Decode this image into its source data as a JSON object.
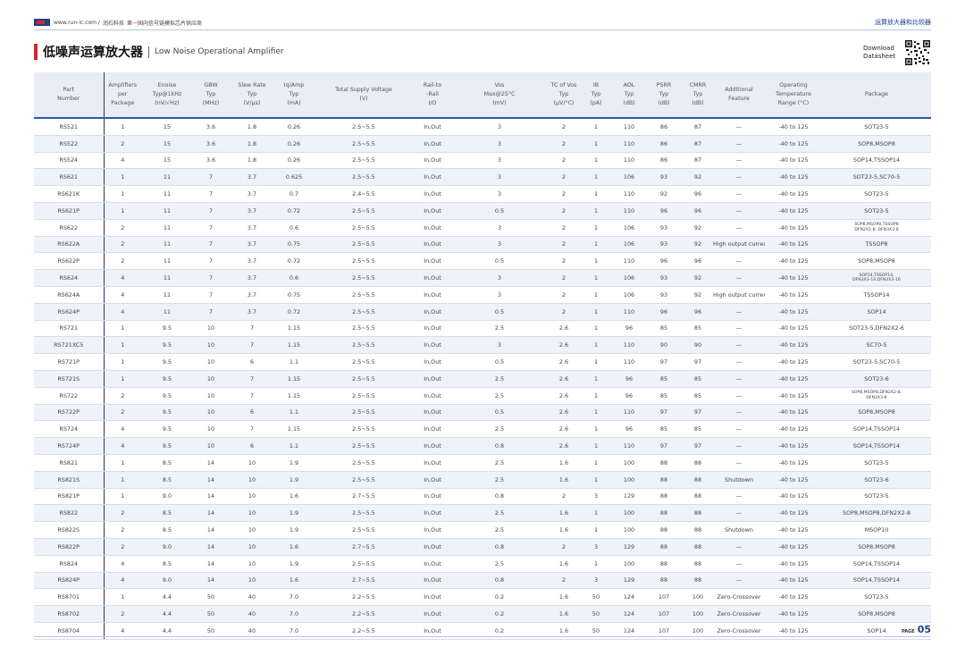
{
  "header": {
    "site_text": "www.run-ic.com /",
    "brand_text": "润石科技",
    "slogan_prefix": "第",
    "slogan_mark": "一",
    "slogan": "国内信号链模拟芯片供应商",
    "category": "运算放大器和比较器"
  },
  "title": {
    "zh": "低噪声运算放大器",
    "en": "Low Noise Operational Amplifier"
  },
  "download": {
    "line1": "Download",
    "line2": "Datasheet"
  },
  "table": {
    "columns": [
      "Part\nNumber",
      "Amplifiers\nper\nPackage",
      "Enoise\nTyp@1kHz\n(nV/√Hz)",
      "GBW\nTyp\n(MHz)",
      "Slew Rate\nTyp\n(V/μs)",
      "Iq/Amp\nTyp\n(mA)",
      "Total Supply Voltage\n(V)",
      "Rail-to\n-Rail\nI/O",
      "Vos\nMax@25°C\n(mV)",
      "TC of Vos\nTyp\n(μV/°C)",
      "IB\nTyp\n(pA)",
      "AOL\nTyp\n(dB)",
      "PSRR\nTyp\n(dB)",
      "CMRR\nTyp\n(dB)",
      "Additional\nFeature",
      "Operating\nTemperature\nRange (°C)",
      "Package"
    ],
    "rows": [
      [
        "RS521",
        "1",
        "15",
        "3.6",
        "1.8",
        "0.26",
        "2.5~5.5",
        "In,Out",
        "3",
        "2",
        "1",
        "110",
        "86",
        "87",
        "—",
        "-40 to 125",
        "SOT23-5"
      ],
      [
        "RS522",
        "2",
        "15",
        "3.6",
        "1.8",
        "0.26",
        "2.5~5.5",
        "In,Out",
        "3",
        "2",
        "1",
        "110",
        "86",
        "87",
        "—",
        "-40 to 125",
        "SOP8,MSOP8"
      ],
      [
        "RS524",
        "4",
        "15",
        "3.6",
        "1.8",
        "0.26",
        "2.5~5.5",
        "In,Out",
        "3",
        "2",
        "1",
        "110",
        "86",
        "87",
        "—",
        "-40 to 125",
        "SOP14,TSSOP14"
      ],
      [
        "RS621",
        "1",
        "11",
        "7",
        "3.7",
        "0.625",
        "2.5~5.5",
        "In,Out",
        "3",
        "2",
        "1",
        "106",
        "93",
        "92",
        "—",
        "-40 to 125",
        "SOT23-5,SC70-5"
      ],
      [
        "RS621K",
        "1",
        "11",
        "7",
        "3.7",
        "0.7",
        "2.4~5.5",
        "In,Out",
        "3",
        "2",
        "1",
        "110",
        "92",
        "96",
        "—",
        "-40 to 125",
        "SOT23-5"
      ],
      [
        "RS621P",
        "1",
        "11",
        "7",
        "3.7",
        "0.72",
        "2.5~5.5",
        "In,Out",
        "0.5",
        "2",
        "1",
        "110",
        "96",
        "96",
        "—",
        "-40 to 125",
        "SOT23-5"
      ],
      [
        "RS622",
        "2",
        "11",
        "7",
        "3.7",
        "0.6",
        "2.5~5.5",
        "In,Out",
        "3",
        "2",
        "1",
        "106",
        "93",
        "92",
        "—",
        "-40 to 125",
        "SOP8,MSOP8,TSSOP8\nDFN2X2-8, DFN3X3-8"
      ],
      [
        "RS622A",
        "2",
        "11",
        "7",
        "3.7",
        "0.75",
        "2.5~5.5",
        "In,Out",
        "3",
        "2",
        "1",
        "106",
        "93",
        "92",
        "High output current",
        "-40 to 125",
        "TSSOP8"
      ],
      [
        "RS622P",
        "2",
        "11",
        "7",
        "3.7",
        "0.72",
        "2.5~5.5",
        "In,Out",
        "0.5",
        "2",
        "1",
        "110",
        "96",
        "96",
        "—",
        "-40 to 125",
        "SOP8,MSOP8"
      ],
      [
        "RS624",
        "4",
        "11",
        "7",
        "3.7",
        "0.6",
        "2.5~5.5",
        "In,Out",
        "3",
        "2",
        "1",
        "106",
        "93",
        "92",
        "—",
        "-40 to 125",
        "SOP14,TSSOP14,\nDFN3X3-14,QFN3X3-16"
      ],
      [
        "RS624A",
        "4",
        "11",
        "7",
        "3.7",
        "0.75",
        "2.5~5.5",
        "In,Out",
        "3",
        "2",
        "1",
        "106",
        "93",
        "92",
        "High output current",
        "-40 to 125",
        "TSSOP14"
      ],
      [
        "RS624P",
        "4",
        "11",
        "7",
        "3.7",
        "0.72",
        "2.5~5.5",
        "In,Out",
        "0.5",
        "2",
        "1",
        "110",
        "96",
        "96",
        "—",
        "-40 to 125",
        "SOP14"
      ],
      [
        "RS721",
        "1",
        "9.5",
        "10",
        "7",
        "1.15",
        "2.5~5.5",
        "In,Out",
        "2.5",
        "2.6",
        "1",
        "96",
        "85",
        "85",
        "—",
        "-40 to 125",
        "SOT23-5,DFN2X2-6"
      ],
      [
        "RS721XC5",
        "1",
        "9.5",
        "10",
        "7",
        "1.15",
        "2.5~5.5",
        "In,Out",
        "3",
        "2.6",
        "1",
        "110",
        "90",
        "90",
        "—",
        "-40 to 125",
        "SC70-5"
      ],
      [
        "RS721P",
        "1",
        "9.5",
        "10",
        "6",
        "1.1",
        "2.5~5.5",
        "In,Out",
        "0.5",
        "2.6",
        "1",
        "110",
        "97",
        "97",
        "—",
        "-40 to 125",
        "SOT23-5,SC70-5"
      ],
      [
        "RS721S",
        "1",
        "9.5",
        "10",
        "7",
        "1.15",
        "2.5~5.5",
        "In,Out",
        "2.5",
        "2.6",
        "1",
        "96",
        "85",
        "85",
        "—",
        "-40 to 125",
        "SOT23-6"
      ],
      [
        "RS722",
        "2",
        "9.5",
        "10",
        "7",
        "1.15",
        "2.5~5.5",
        "In,Out",
        "2.5",
        "2.6",
        "1",
        "96",
        "85",
        "85",
        "—",
        "-40 to 125",
        "SOP8,MSOP8,DFN2X2-8,\nDFN3X3-8"
      ],
      [
        "RS722P",
        "2",
        "9.5",
        "10",
        "6",
        "1.1",
        "2.5~5.5",
        "In,Out",
        "0.5",
        "2.6",
        "1",
        "110",
        "97",
        "97",
        "—",
        "-40 to 125",
        "SOP8,MSOP8"
      ],
      [
        "RS724",
        "4",
        "9.5",
        "10",
        "7",
        "1.15",
        "2.5~5.5",
        "In,Out",
        "2.5",
        "2.6",
        "1",
        "96",
        "85",
        "85",
        "—",
        "-40 to 125",
        "SOP14,TSSOP14"
      ],
      [
        "RS724P",
        "4",
        "9.5",
        "10",
        "6",
        "1.1",
        "2.5~5.5",
        "In,Out",
        "0.8",
        "2.6",
        "1",
        "110",
        "97",
        "97",
        "—",
        "-40 to 125",
        "SOP14,TSSOP14"
      ],
      [
        "RS821",
        "1",
        "8.5",
        "14",
        "10",
        "1.9",
        "2.5~5.5",
        "In,Out",
        "2.5",
        "1.6",
        "1",
        "100",
        "88",
        "88",
        "—",
        "-40 to 125",
        "SOT23-5"
      ],
      [
        "RS821S",
        "1",
        "8.5",
        "14",
        "10",
        "1.9",
        "2.5~5.5",
        "In,Out",
        "2.5",
        "1.6",
        "1",
        "100",
        "88",
        "88",
        "Shutdown",
        "-40 to 125",
        "SOT23-6"
      ],
      [
        "RS821P",
        "1",
        "9.0",
        "14",
        "10",
        "1.6",
        "2.7~5.5",
        "In,Out",
        "0.8",
        "2",
        "3",
        "129",
        "88",
        "88",
        "—",
        "-40 to 125",
        "SOT23-5"
      ],
      [
        "RS822",
        "2",
        "8.5",
        "14",
        "10",
        "1.9",
        "2.5~5.5",
        "In,Out",
        "2.5",
        "1.6",
        "1",
        "100",
        "88",
        "88",
        "—",
        "-40 to 125",
        "SOP8,MSOP8,DFN2X2-8"
      ],
      [
        "RS822S",
        "2",
        "8.5",
        "14",
        "10",
        "1.9",
        "2.5~5.5",
        "In,Out",
        "2.5",
        "1.6",
        "1",
        "100",
        "88",
        "88",
        "Shutdown",
        "-40 to 125",
        "MSOP10"
      ],
      [
        "RS822P",
        "2",
        "9.0",
        "14",
        "10",
        "1.6",
        "2.7~5.5",
        "In,Out",
        "0.8",
        "2",
        "3",
        "129",
        "88",
        "88",
        "—",
        "-40 to 125",
        "SOP8,MSOP8"
      ],
      [
        "RS824",
        "4",
        "8.5",
        "14",
        "10",
        "1.9",
        "2.5~5.5",
        "In,Out",
        "2.5",
        "1.6",
        "1",
        "100",
        "88",
        "88",
        "—",
        "-40 to 125",
        "SOP14,TSSOP14"
      ],
      [
        "RS824P",
        "4",
        "9.0",
        "14",
        "10",
        "1.6",
        "2.7~5.5",
        "In,Out",
        "0.8",
        "2",
        "3",
        "129",
        "88",
        "88",
        "—",
        "-40 to 125",
        "SOP14,TSSOP14"
      ],
      [
        "RS8701",
        "1",
        "4.4",
        "50",
        "40",
        "7.0",
        "2.2~5.5",
        "In,Out",
        "0.2",
        "1.6",
        "50",
        "124",
        "107",
        "100",
        "Zero-Crossover",
        "-40 to 125",
        "SOT23-5"
      ],
      [
        "RS8702",
        "2",
        "4.4",
        "50",
        "40",
        "7.0",
        "2.2~5.5",
        "In,Out",
        "0.2",
        "1.6",
        "50",
        "124",
        "107",
        "100",
        "Zero-Crossover",
        "-40 to 125",
        "SOP8,MSOP8"
      ],
      [
        "RS8704",
        "4",
        "4.4",
        "50",
        "40",
        "7.0",
        "2.2~5.5",
        "In,Out",
        "0.2",
        "1.6",
        "50",
        "124",
        "107",
        "100",
        "Zero-Crossover",
        "-40 to 125",
        "SOP14"
      ]
    ]
  },
  "footer": {
    "page_label": "PAGE",
    "page_number": "05"
  }
}
